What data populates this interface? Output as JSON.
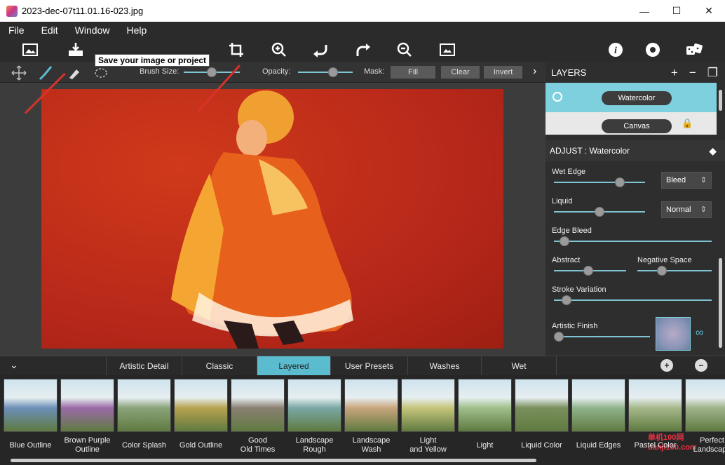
{
  "window": {
    "title": "2023-dec-07t11.01.16-023.jpg",
    "minimize": "—",
    "maximize": "☐",
    "close": "✕"
  },
  "menu": [
    "File",
    "Edit",
    "Window",
    "Help"
  ],
  "toolbar": {
    "tooltip": "Save your image or project"
  },
  "options": {
    "brush_size_label": "Brush Size:",
    "opacity_label": "Opacity:",
    "mask_label": "Mask:",
    "fill": "Fill",
    "clear": "Clear",
    "invert": "Invert",
    "brush_size_value": 0.5,
    "opacity_value": 0.67
  },
  "layers": {
    "title": "LAYERS",
    "items": [
      {
        "name": "Watercolor"
      },
      {
        "name": "Canvas"
      }
    ]
  },
  "adjust": {
    "title": "ADJUST : Watercolor",
    "wet_edge": {
      "label": "Wet Edge",
      "value": 0.75,
      "mode": "Bleed"
    },
    "liquid": {
      "label": "Liquid",
      "value": 0.5,
      "mode": "Normal"
    },
    "edge_bleed": {
      "label": "Edge Bleed",
      "value": 0.04
    },
    "abstract": {
      "label": "Abstract",
      "value": 0.47
    },
    "negative_space": {
      "label": "Negative Space",
      "value": 0.3
    },
    "stroke_variation": {
      "label": "Stroke Variation",
      "value": 0.05
    },
    "artistic_finish": {
      "label": "Artistic Finish",
      "value": 0.0
    }
  },
  "tabs": [
    "Artistic Detail",
    "Classic",
    "Layered",
    "User Presets",
    "Washes",
    "Wet"
  ],
  "active_tab": "Layered",
  "presets": [
    "Blue Outline",
    "Brown Purple\nOutline",
    "Color Splash",
    "Gold Outline",
    "Good\nOld Times",
    "Landscape\nRough",
    "Landscape\nWash",
    "Light\nand Yellow",
    "Light",
    "Liquid Color",
    "Liquid Edges",
    "Pastel Color",
    "Perfect\nLandscape"
  ],
  "watermark": "单机100网\ndanji100.com",
  "colors": {
    "accent": "#5bbcd0",
    "arrow": "#d9322a"
  }
}
